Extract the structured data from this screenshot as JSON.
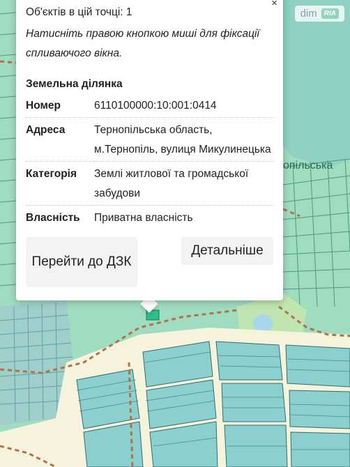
{
  "badge": {
    "dim": "dim",
    "ria": "RIA"
  },
  "map": {
    "street_label": "опільська"
  },
  "popup": {
    "close_glyph": "×",
    "objects_count": "Об'єктів в цій точці: 1",
    "hint": "Натисніть правою кнопкою миші для фіксації спливаючого вікна.",
    "section_title": "Земельна ділянка",
    "rows": [
      {
        "key": "Номер",
        "value": "6110100000:10:001:0414"
      },
      {
        "key": "Адреса",
        "value": "Тернопільська область, м.Тернопіль, вулиця Микулинецька"
      },
      {
        "key": "Категорія",
        "value": "Землі житлової та громадської забудови"
      },
      {
        "key": "Власність",
        "value": "Приватна власність"
      }
    ],
    "btn_dzk": "Перейти до ДЗК",
    "btn_more": "Детальніше"
  },
  "colors": {
    "map_green": "#9fdcc0",
    "parcel_teal": "#8ccfcf",
    "parcel_stroke": "#2e7d5a",
    "road_cream": "#f6f3dc",
    "boundary": "#b3704a",
    "water": "#a8d6ea"
  }
}
